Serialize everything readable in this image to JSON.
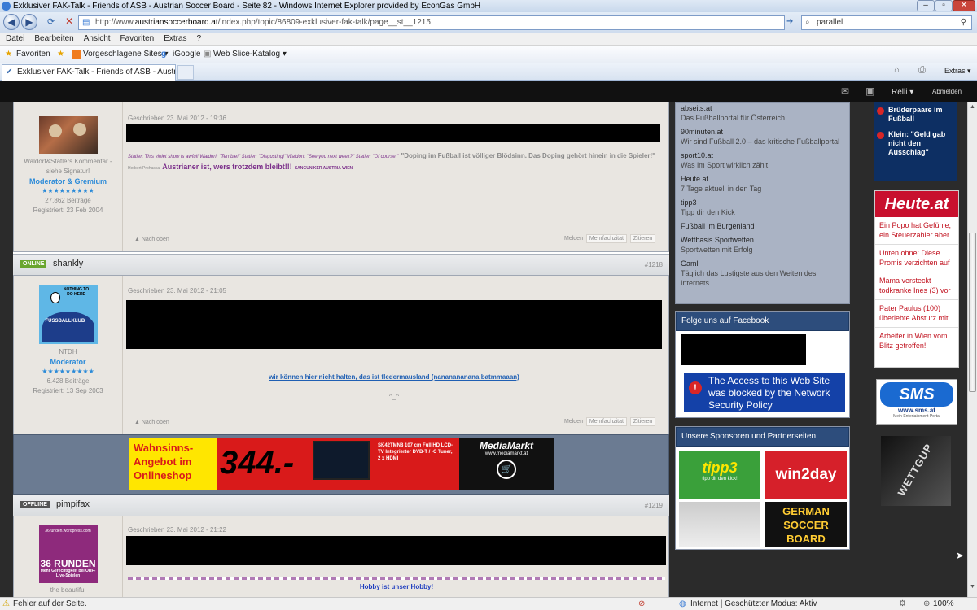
{
  "browser": {
    "title": "Exklusiver FAK-Talk - Friends of ASB - Austrian Soccer Board - Seite 82 - Windows Internet Explorer provided by EconGas GmbH",
    "url_prefix": "http://www.",
    "url_domain": "austriansoccerboard.at",
    "url_path": "/index.php/topic/86809-exklusiver-fak-talk/page__st__1215",
    "search_value": "parallel",
    "menu": [
      "Datei",
      "Bearbeiten",
      "Ansicht",
      "Favoriten",
      "Extras",
      "?"
    ],
    "favorites_label": "Favoriten",
    "fav_items": [
      "Vorgeschlagene Sites ▾",
      "iGoogle",
      "Web Slice-Katalog ▾"
    ],
    "tab_title": "Exklusiver FAK-Talk - Friends of ASB - Austrian So...",
    "extras_label": "Extras ▾",
    "status_left": "Fehler auf der Seite.",
    "status_zone": "Internet | Geschützter Modus: Aktiv",
    "zoom": "100%"
  },
  "site": {
    "user": "Relli ▾",
    "logout": "Abmelden"
  },
  "posts": [
    {
      "profile_text": "Waldorf&Statlers Kommentar - siehe Signatur!",
      "role": "Moderator & Gremium",
      "stars": "★★★★★★★★★",
      "count": "27.862 Beiträge",
      "registered": "Registriert: 23 Feb 2004",
      "date": "Geschrieben 23. Mai 2012 - 19:36",
      "sig_small": "Statler: This violet show is awful! Waldorf: \"Terrible!\" Statler: \"Disgusting!\" Waldorf: \"See you next week?\" Statler: \"Of course.\"",
      "sig_quote": "\"Doping im Fußball ist völliger Blödsinn. Das Doping gehört hinein in die Spieler!\"",
      "sig_author": "Herbert Prohaska",
      "sig_purple": "Austrianer ist, wers trotzdem bleibt!!!",
      "sig_tail": "SANGUNIKER AUSTRIA WIEN",
      "up": "▲ Nach oben",
      "report": "Melden",
      "multi": "Mehrfachzitat",
      "quote": "Zitieren"
    },
    {
      "status": "ONLINE",
      "username": "shankly",
      "number": "#1218",
      "avatar_top": "NOTHING TO DO HERE",
      "avatar_ring": "FUSSBALLKLUB",
      "profile_text": "NTDH",
      "role": "Moderator",
      "stars": "★★★★★★★★★",
      "count": "6.428 Beiträge",
      "registered": "Registriert: 13 Sep 2003",
      "date": "Geschrieben 23. Mai 2012 - 21:05",
      "sig_link": "wir können hier nicht halten, das ist fledermausland (nananananana batmmaaan)",
      "sig_face": "^_^",
      "up": "▲ Nach oben",
      "report": "Melden",
      "multi": "Mehrfachzitat",
      "quote": "Zitieren"
    },
    {
      "status": "OFFLINE",
      "username": "pimpifax",
      "number": "#1219",
      "avatar_top": "36runden.wordpress.com",
      "avatar_big": "36 RUNDEN",
      "avatar_bottom": "Mehr Gerechtigkeit bei ORF-Live-Spielen",
      "profile_text": "the beautiful",
      "date": "Geschrieben 23. Mai 2012 - 21:22",
      "sig_hobby": "Hobby ist unser Hobby!"
    }
  ],
  "banner": {
    "left": "Wahnsinns-Angebot im Onlineshop",
    "price": "344.-",
    "product": "SK42TMN8 107 cm Full HD LCD-TV Integrierter DVB-T / -C Tuner, 2 x HDMI",
    "brand": "MediaMarkt",
    "site": "www.mediamarkt.at"
  },
  "sidebar": {
    "links": [
      {
        "name": "abseits.at",
        "desc": "Das Fußballportal für Österreich"
      },
      {
        "name": "90minuten.at",
        "desc": "Wir sind Fußball 2.0 – das kritische Fußballportal"
      },
      {
        "name": "sport10.at",
        "desc": "Was im Sport wirklich zählt"
      },
      {
        "name": "Heute.at",
        "desc": "7 Tage aktuell in den Tag"
      },
      {
        "name": "tipp3",
        "desc": "Tipp dir den Kick"
      },
      {
        "name": "Fußball im Burgenland",
        "desc": ""
      },
      {
        "name": "Wettbasis Sportwetten",
        "desc": "Sportwetten mit Erfolg"
      },
      {
        "name": "Gamli",
        "desc": "Täglich das Lustigste aus den Weiten des Internets"
      }
    ],
    "facebook_head": "Folge uns auf Facebook",
    "blocked": "The Access to this Web Site was blocked by the Network Security Policy",
    "sponsors_head": "Unsere Sponsoren und Partnerseiten",
    "sponsors": [
      "tipp3",
      "tipp dir den kick!",
      "win2day",
      "GERMAN SOCCER BOARD"
    ]
  },
  "farright": {
    "top_news": [
      "Brüderpaare im Fußball",
      "Klein: \"Geld gab nicht den Ausschlag\""
    ],
    "heute_logo": "Heute.at",
    "heute_news": [
      "Ein Popo hat Gefühle, ein Steuerzahler aber",
      "Unten ohne: Diese Promis verzichten auf",
      "Mama versteckt todkranke Ines (3) vor",
      "Pater Paulus (100) überlebte Absturz mit",
      "Arbeiter in Wien vom Blitz getroffen!"
    ],
    "sms_logo": "SMS",
    "sms_url": "www.sms.at",
    "sms_tag": "Mein Entertainment Portal",
    "wettgup": "WETTGUP"
  }
}
